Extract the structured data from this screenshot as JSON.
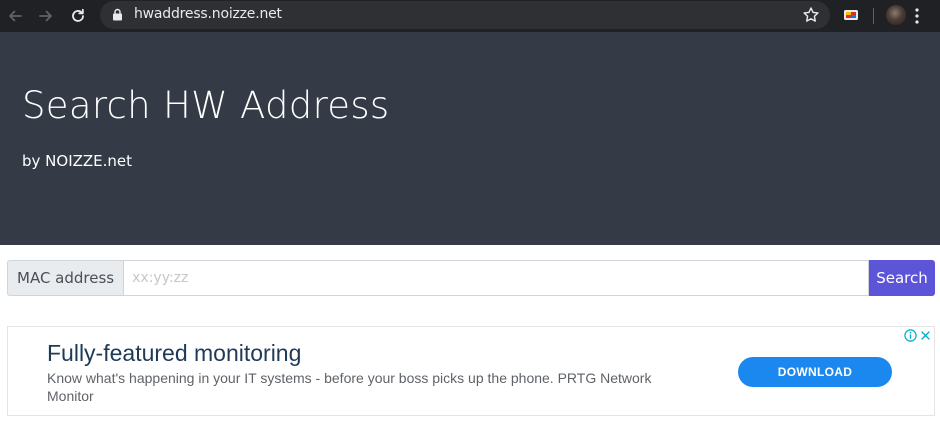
{
  "browser": {
    "url": "hwaddress.noizze.net",
    "icons": {
      "back": "back-arrow-icon",
      "forward": "forward-arrow-icon",
      "reload": "reload-icon",
      "lock": "lock-icon",
      "bookmark": "star-icon",
      "extension": "cast-extension-icon",
      "profile": "avatar",
      "menu": "kebab-menu-icon"
    }
  },
  "header": {
    "title": "Search HW Address",
    "subtitle": "by NOIZZE.net"
  },
  "search": {
    "label": "MAC address",
    "placeholder": "xx:yy:zz",
    "value": "",
    "button_label": "Search"
  },
  "ad": {
    "headline": "Fully-featured monitoring",
    "body": "Know what's happening in your IT systems - before your boss picks up the phone. PRTG Network Monitor",
    "cta_label": "DOWNLOAD",
    "icons": {
      "info": "adchoices-info-icon",
      "close": "close-icon"
    }
  },
  "colors": {
    "chrome_bg": "#202124",
    "hero_bg": "#343a46",
    "search_button": "#5d55d8",
    "ad_cta": "#1a88ee",
    "ad_headline": "#1f3a57"
  }
}
